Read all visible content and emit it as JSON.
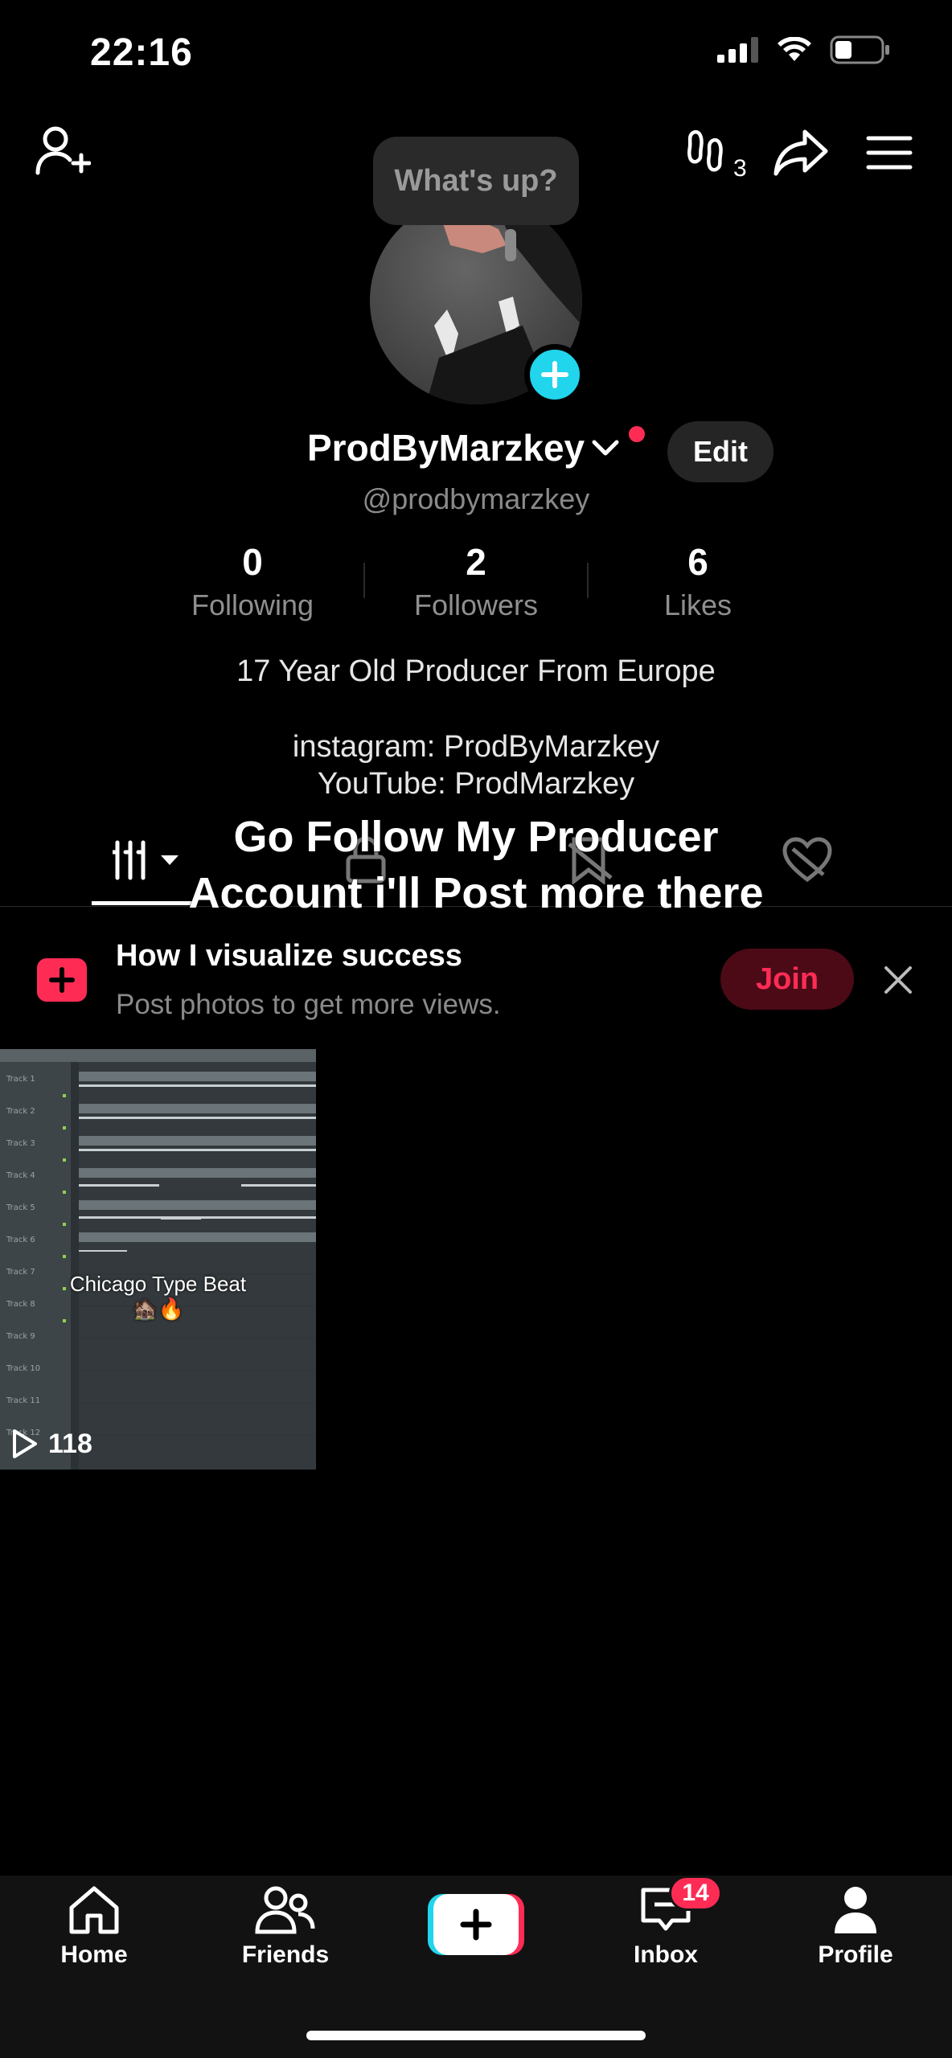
{
  "status": {
    "time": "22:16"
  },
  "bubble": {
    "text": "What's up?"
  },
  "profile": {
    "username": "ProdByMarzkey",
    "handle": "@prodbymarzkey",
    "edit_label": "Edit",
    "stats": [
      {
        "value": "0",
        "label": "Following"
      },
      {
        "value": "2",
        "label": "Followers"
      },
      {
        "value": "6",
        "label": "Likes"
      }
    ],
    "bio": {
      "line1": "17 Year Old Producer From Europe",
      "line2": "instagram: ProdByMarzkey",
      "line3": "YouTube: ProdMarzkey"
    },
    "overlay": {
      "line1": "Go Follow My Producer",
      "line2": "Account i'll Post more there"
    }
  },
  "promo": {
    "title": "How I visualize success",
    "subtitle": "Post photos to get more views.",
    "join_label": "Join"
  },
  "videos": [
    {
      "caption": "Chicago Type Beat",
      "emoji": "🏚️🔥",
      "views": "118"
    }
  ],
  "nav": {
    "home": "Home",
    "friends": "Friends",
    "inbox": "Inbox",
    "inbox_badge": "14",
    "profile": "Profile"
  },
  "colors": {
    "accent": "#fe2c55",
    "cyan": "#20d5ec",
    "background": "#000000"
  }
}
